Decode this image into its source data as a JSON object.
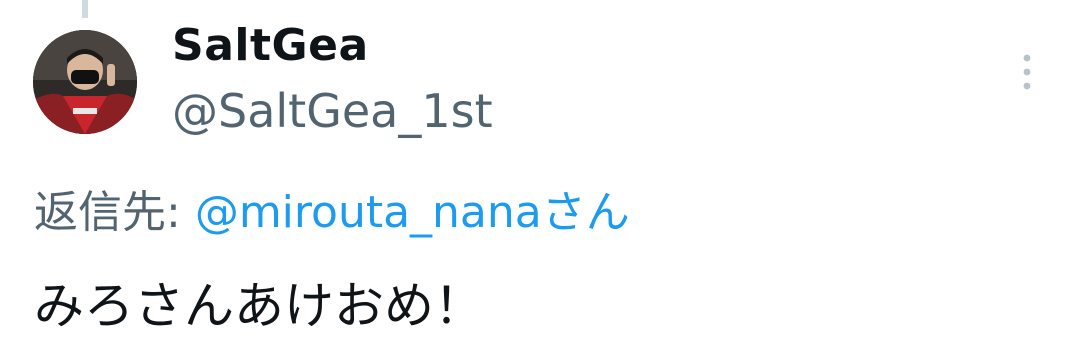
{
  "author": {
    "display_name": "SaltGea",
    "handle": "@SaltGea_1st",
    "avatar_icon": "user-photo"
  },
  "reply": {
    "prefix": "返信先: ",
    "mention": "@mirouta_nanaさん"
  },
  "tweet": {
    "text": "みろさんあけおめ！"
  },
  "menu": {
    "icon": "more-vertical-icon"
  },
  "colors": {
    "primary_text": "#0f1419",
    "secondary_text": "#536471",
    "link": "#1d9bf0",
    "thread_line": "#cfd9de"
  }
}
